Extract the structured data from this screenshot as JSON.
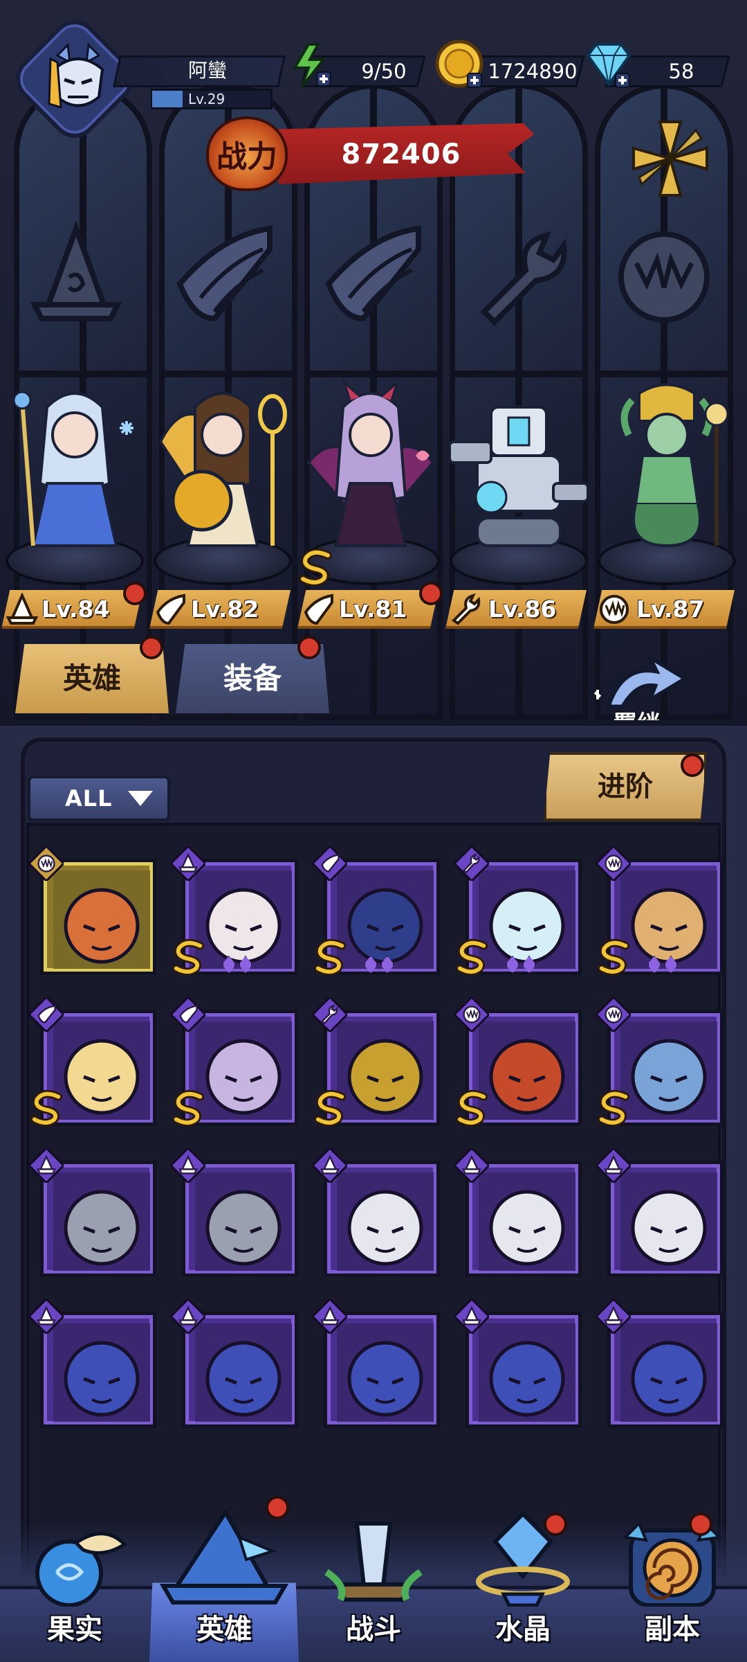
{
  "player": {
    "name": "阿蠻",
    "level": "Lv.29",
    "level_progress": 0.26
  },
  "resources": {
    "energy": "9/50",
    "gold": "1724890",
    "diamonds": "58"
  },
  "power": {
    "label": "战力",
    "value": "872406"
  },
  "team": [
    {
      "level": "Lv.84",
      "class_icon": "mage-hat-icon",
      "has_alert": true
    },
    {
      "level": "Lv.82",
      "class_icon": "wing-icon",
      "has_alert": false
    },
    {
      "level": "Lv.81",
      "class_icon": "wing-icon",
      "has_alert": true,
      "grade": "S"
    },
    {
      "level": "Lv.86",
      "class_icon": "wrench-icon",
      "has_alert": false
    },
    {
      "level": "Lv.87",
      "class_icon": "beast-claw-icon",
      "has_alert": false
    }
  ],
  "tabs": {
    "heroes": "英雄",
    "equipment": "装备"
  },
  "bond": {
    "label": "羁绊"
  },
  "filter": {
    "label": "ALL"
  },
  "advance": {
    "label": "进阶"
  },
  "hero_grid": [
    {
      "class_icon": "beast-claw-icon",
      "rarity": "gold",
      "grade": "",
      "stars": 0
    },
    {
      "class_icon": "mage-hat-icon",
      "rarity": "purple",
      "grade": "S",
      "stars": 2
    },
    {
      "class_icon": "wing-icon",
      "rarity": "purple",
      "grade": "S",
      "stars": 2
    },
    {
      "class_icon": "wrench-icon",
      "rarity": "purple",
      "grade": "S",
      "stars": 2
    },
    {
      "class_icon": "beast-claw-icon",
      "rarity": "purple",
      "grade": "S",
      "stars": 2
    },
    {
      "class_icon": "wing-icon",
      "rarity": "purple",
      "grade": "S",
      "stars": 0
    },
    {
      "class_icon": "wing-icon",
      "rarity": "purple",
      "grade": "S",
      "stars": 0
    },
    {
      "class_icon": "wrench-icon",
      "rarity": "purple",
      "grade": "S",
      "stars": 0
    },
    {
      "class_icon": "beast-claw-icon",
      "rarity": "purple",
      "grade": "S",
      "stars": 0
    },
    {
      "class_icon": "beast-claw-icon",
      "rarity": "purple",
      "grade": "S",
      "stars": 0
    },
    {
      "class_icon": "mage-hat-icon",
      "rarity": "purple",
      "grade": "",
      "stars": 0
    },
    {
      "class_icon": "mage-hat-icon",
      "rarity": "purple",
      "grade": "",
      "stars": 0
    },
    {
      "class_icon": "mage-hat-icon",
      "rarity": "purple",
      "grade": "",
      "stars": 0
    },
    {
      "class_icon": "mage-hat-icon",
      "rarity": "purple",
      "grade": "",
      "stars": 0
    },
    {
      "class_icon": "mage-hat-icon",
      "rarity": "purple",
      "grade": "",
      "stars": 0
    },
    {
      "class_icon": "mage-hat-icon",
      "rarity": "purple",
      "grade": "",
      "stars": 0
    },
    {
      "class_icon": "mage-hat-icon",
      "rarity": "purple",
      "grade": "",
      "stars": 0
    },
    {
      "class_icon": "mage-hat-icon",
      "rarity": "purple",
      "grade": "",
      "stars": 0
    },
    {
      "class_icon": "mage-hat-icon",
      "rarity": "purple",
      "grade": "",
      "stars": 0
    },
    {
      "class_icon": "mage-hat-icon",
      "rarity": "purple",
      "grade": "",
      "stars": 0
    }
  ],
  "nav": [
    {
      "label": "果实",
      "icon": "fruit-icon",
      "active": false,
      "has_alert": false
    },
    {
      "label": "英雄",
      "icon": "hero-hat-icon",
      "active": true,
      "has_alert": true
    },
    {
      "label": "战斗",
      "icon": "battle-sword-icon",
      "active": false,
      "has_alert": false
    },
    {
      "label": "水晶",
      "icon": "crystal-icon",
      "active": false,
      "has_alert": true
    },
    {
      "label": "副本",
      "icon": "dungeon-portal-icon",
      "active": false,
      "has_alert": true
    }
  ],
  "colors": {
    "accent_gold": "#e6b35a",
    "card_purple": "#4b2f8e",
    "alert_red": "#d63c2e",
    "power_red": "#b62624"
  }
}
